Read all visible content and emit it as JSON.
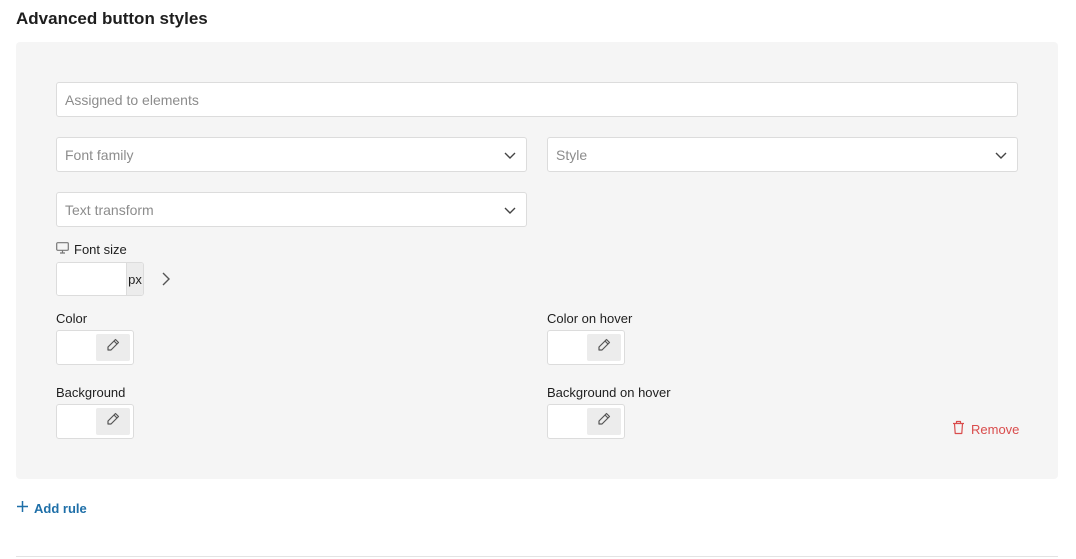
{
  "section": {
    "title": "Advanced button styles"
  },
  "panel": {
    "assigned": {
      "placeholder": "Assigned to elements",
      "value": ""
    },
    "font_family": {
      "placeholder": "Font family",
      "icon": "chevron-down-icon"
    },
    "style": {
      "placeholder": "Style",
      "icon": "chevron-down-icon"
    },
    "text_transform": {
      "placeholder": "Text transform",
      "icon": "chevron-down-icon"
    },
    "font_size": {
      "label": "Font size",
      "device_icon": "desktop-icon",
      "value": "",
      "unit": "px",
      "next_icon": "chevron-right-icon"
    },
    "color": {
      "label": "Color",
      "icon": "eyedropper-icon"
    },
    "color_hover": {
      "label": "Color on hover",
      "icon": "eyedropper-icon"
    },
    "background": {
      "label": "Background",
      "icon": "eyedropper-icon"
    },
    "background_hover": {
      "label": "Background on hover",
      "icon": "eyedropper-icon"
    },
    "remove": {
      "label": "Remove",
      "icon": "trash-icon",
      "color": "#d94c4c"
    }
  },
  "add_rule": {
    "label": "Add rule",
    "icon": "plus-icon",
    "color": "#1e6fa8"
  }
}
